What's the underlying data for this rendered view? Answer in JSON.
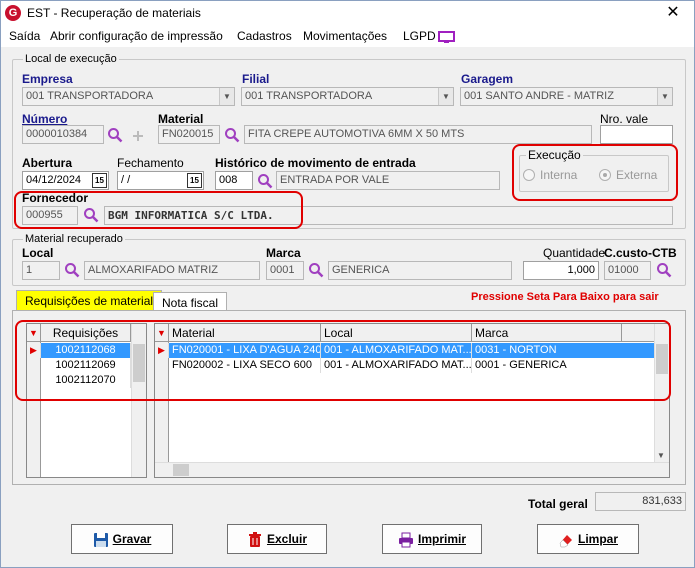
{
  "window": {
    "title": "EST - Recuperação de materiais",
    "close": "✕"
  },
  "menu": [
    "Saída",
    "Abrir configuração de impressão",
    "Cadastros",
    "Movimentações",
    "LGPD"
  ],
  "local_execucao": {
    "group_title": "Local de execução",
    "empresa": {
      "label": "Empresa",
      "value": "001 TRANSPORTADORA"
    },
    "filial": {
      "label": "Filial",
      "value": "001 TRANSPORTADORA"
    },
    "garagem": {
      "label": "Garagem",
      "value": "001 SANTO ANDRE - MATRIZ"
    },
    "numero": {
      "label": "Número",
      "value": "0000010384"
    },
    "material": {
      "label": "Material",
      "code": "FN020015",
      "desc": "FITA CREPE AUTOMOTIVA 6MM X 50 MTS"
    },
    "nro_vale": {
      "label": "Nro. vale",
      "value": ""
    },
    "abertura": {
      "label": "Abertura",
      "value": "04/12/2024"
    },
    "fechamento": {
      "label": "Fechamento",
      "value": " / /"
    },
    "historico": {
      "label": "Histórico de movimento de entrada",
      "code": "008",
      "desc": "ENTRADA POR VALE"
    },
    "execucao": {
      "label": "Execução",
      "interna": "Interna",
      "externa": "Externa"
    },
    "fornecedor": {
      "label": "Fornecedor",
      "code": "000955",
      "desc": "BGM INFORMATICA S/C LTDA."
    },
    "calendar_glyph": "15"
  },
  "material_recuperado": {
    "group_title": "Material recuperado",
    "local": {
      "label": "Local",
      "code": "1",
      "desc": "ALMOXARIFADO MATRIZ"
    },
    "marca": {
      "label": "Marca",
      "code": "0001",
      "desc": "GENERICA"
    },
    "quantidade": {
      "label": "Quantidade",
      "value": "1,000"
    },
    "ccusto": {
      "label": "C.custo-CTB",
      "value": "01000"
    }
  },
  "tabs": {
    "req": "Requisições de material",
    "nota": "Nota fiscal"
  },
  "hint": "Pressione Seta Para Baixo para sair",
  "req_grid": {
    "header": "Requisições",
    "rows": [
      "1002112068",
      "1002112069",
      "1002112070"
    ]
  },
  "mat_grid": {
    "headers": [
      "Material",
      "Local",
      "Marca"
    ],
    "rows": [
      [
        "FN020001 - LIXA D'AGUA 240",
        "001 - ALMOXARIFADO MAT...",
        "0031 - NORTON"
      ],
      [
        "FN020002 - LIXA SECO 600",
        "001 - ALMOXARIFADO MAT...",
        "0001 - GENERICA"
      ]
    ]
  },
  "total": {
    "label": "Total geral",
    "value": "831,633"
  },
  "buttons": {
    "gravar": "Gravar",
    "excluir": "Excluir",
    "imprimir": "Imprimir",
    "limpar": "Limpar"
  },
  "colors": {
    "accent_red": "#e00000",
    "label_blue": "#1a1a8c",
    "selection": "#3399ff",
    "tab_active": "#ffff00",
    "hint": "#e00000"
  }
}
